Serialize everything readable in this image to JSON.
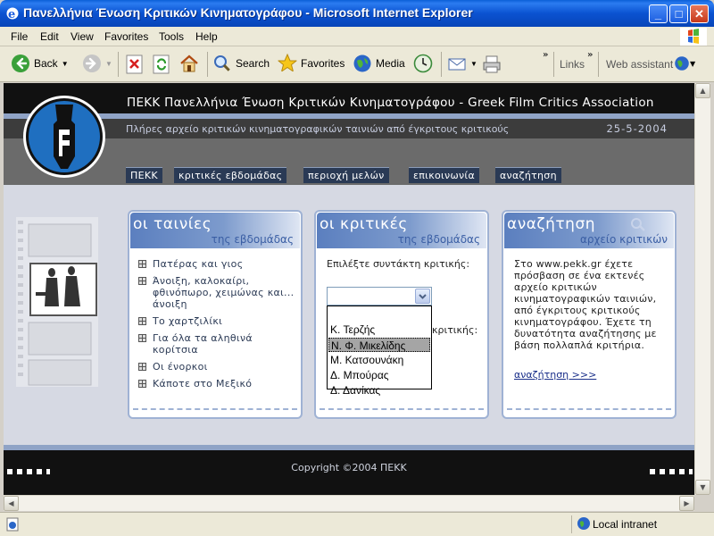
{
  "window": {
    "title": "Πανελλήνια Ένωση Κριτικών Κινηματογράφου - Microsoft Internet Explorer",
    "min_label": "_",
    "max_label": "□",
    "close_label": "✕"
  },
  "menubar": {
    "items": [
      "File",
      "Edit",
      "View",
      "Favorites",
      "Tools",
      "Help"
    ]
  },
  "toolbar": {
    "back_label": "Back",
    "search_label": "Search",
    "favorites_label": "Favorites",
    "media_label": "Media",
    "links_label": "Links",
    "web_assistant_label": "Web assistant",
    "more_glyph": "»"
  },
  "site": {
    "title": "ΠΕΚΚ Πανελλήνια Ένωση Κριτικών Κινηματογράφου - Greek Film Critics Association",
    "tagline": "Πλήρες αρχείο κριτικών κινηματογραφικών ταινιών από έγκριτους κριτικούς",
    "date": "25-5-2004",
    "nav": [
      "ΠΕΚΚ",
      "κριτικές εβδομάδας",
      "περιοχή μελών",
      "επικοινωνία",
      "αναζήτηση"
    ]
  },
  "panels": {
    "movies": {
      "title": "οι ταινίες",
      "subtitle": "της εβδομάδας",
      "items": [
        "Πατέρας και γιος",
        "Άνοιξη, καλοκαίρι, φθινόπωρο, χειμώνας και... άνοιξη",
        "Το χαρτζιλίκι",
        "Για όλα τα αληθινά κορίτσια",
        "Οι ένορκοι",
        "Κάποτε στο Μεξικό"
      ]
    },
    "critics": {
      "title": "οι κριτικές",
      "subtitle": "της εβδομάδας",
      "select_label": "Επιλέξτε συντάκτη κριτικής:",
      "second_label": "κριτικής:",
      "selected_value": "",
      "options": [
        "",
        "Κ. Τερζής",
        "Ν. Φ. Μικελίδης",
        "Μ. Κατσουνάκη",
        "Δ. Μπούρας",
        "Δ. Δανίκας"
      ],
      "highlighted_option": "Ν. Φ. Μικελίδης"
    },
    "search": {
      "title": "αναζήτηση",
      "subtitle": "αρχείο κριτικών",
      "description": "Στο www.pekk.gr έχετε πρόσβαση σε ένα εκτενές αρχείο κριτικών κινηματογραφικών ταινιών, από έγκριτους κριτικούς κινηματογράφου. Έχετε τη δυνατότητα αναζήτησης με βάση πολλαπλά κριτήρια.",
      "link": "αναζήτηση >>>"
    }
  },
  "footer": {
    "copyright": "Copyright ©2004 ΠΕΚΚ"
  },
  "statusbar": {
    "zone": "Local intranet"
  },
  "colors": {
    "ie_title_blue": "#0a52d1",
    "panel_border": "#9fb2d4",
    "panel_header": "#5b7fbf",
    "nav_bg": "#2a3a55",
    "page_bg": "#d6d9e3"
  }
}
